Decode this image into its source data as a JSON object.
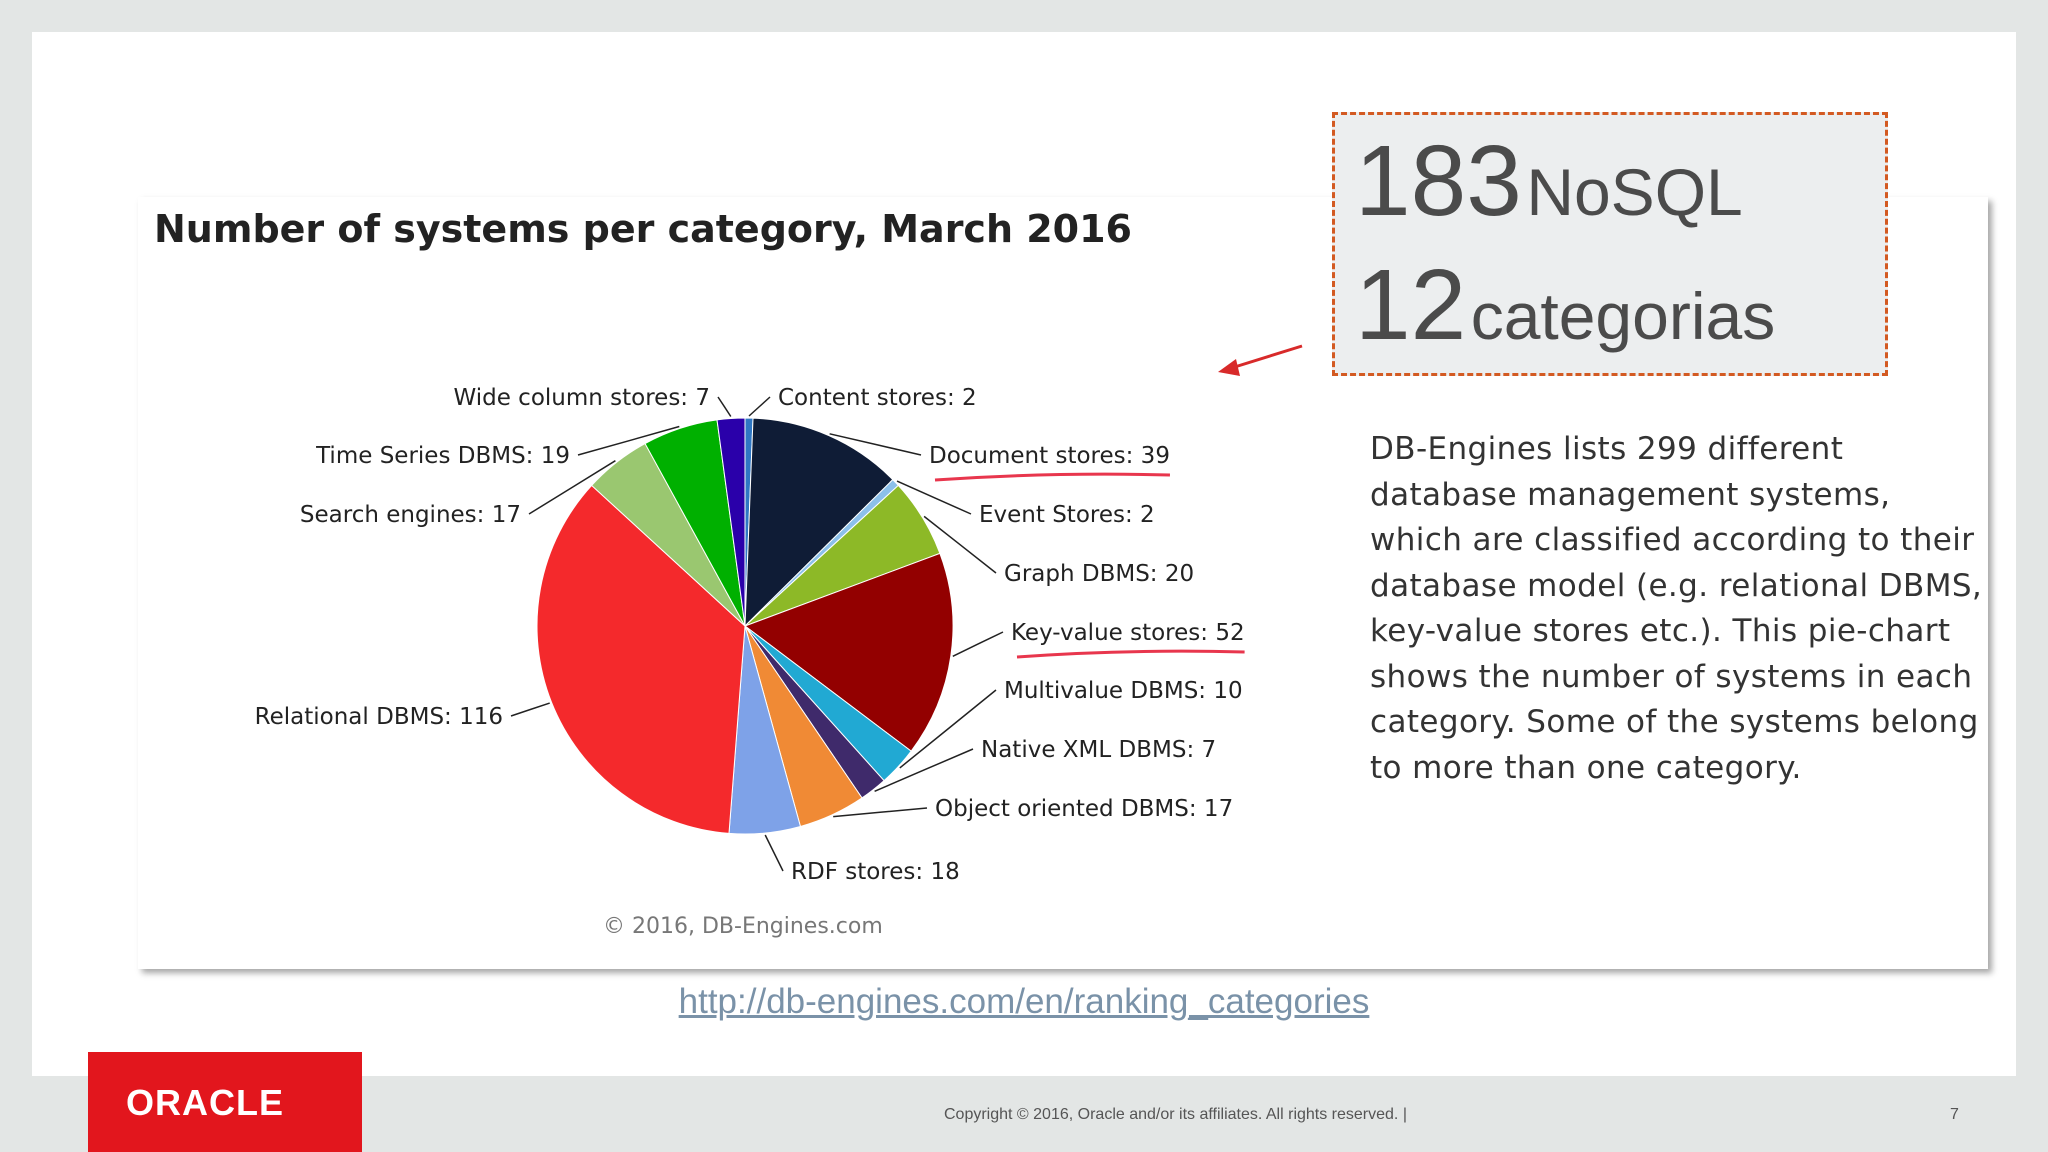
{
  "chart_data": {
    "type": "pie",
    "title": "Number of systems per category, March 2016",
    "credit": "© 2016, DB-Engines.com",
    "slices": [
      {
        "label": "Content stores",
        "value": 2,
        "color": "#2f77c4"
      },
      {
        "label": "Document stores",
        "value": 39,
        "color": "#0f1c36"
      },
      {
        "label": "Event Stores",
        "value": 2,
        "color": "#8cc0ea"
      },
      {
        "label": "Graph DBMS",
        "value": 20,
        "color": "#8db927"
      },
      {
        "label": "Key-value stores",
        "value": 52,
        "color": "#930000"
      },
      {
        "label": "Multivalue DBMS",
        "value": 10,
        "color": "#21a9d3"
      },
      {
        "label": "Native XML DBMS",
        "value": 7,
        "color": "#3f2a6b"
      },
      {
        "label": "Object oriented DBMS",
        "value": 17,
        "color": "#f08a35"
      },
      {
        "label": "RDF stores",
        "value": 18,
        "color": "#7ea2e8"
      },
      {
        "label": "Relational DBMS",
        "value": 116,
        "color": "#f4292c"
      },
      {
        "label": "Search engines",
        "value": 17,
        "color": "#9ac770"
      },
      {
        "label": "Time Series DBMS",
        "value": 19,
        "color": "#00b000"
      },
      {
        "label": "Wide column stores",
        "value": 7,
        "color": "#2a00aa"
      }
    ],
    "underlined_labels": [
      "Document stores",
      "Key-value stores"
    ],
    "underline_color": "#e8364d"
  },
  "callout": {
    "num1": "183",
    "word1": "NoSQL",
    "num2": "12",
    "word2": "categorias"
  },
  "description": "DB-Engines lists 299 different database management systems, which are classified according to their database model (e.g. relational DBMS, key-value stores etc.). This pie-chart shows the number of systems in each category. Some of the systems belong to more than one category.",
  "source_link": "http://db-engines.com/en/ranking_categories",
  "footer": {
    "logo": "ORACLE",
    "copyright": "Copyright © 2016, Oracle and/or its affiliates. All rights reserved. |",
    "page_number": "7"
  }
}
